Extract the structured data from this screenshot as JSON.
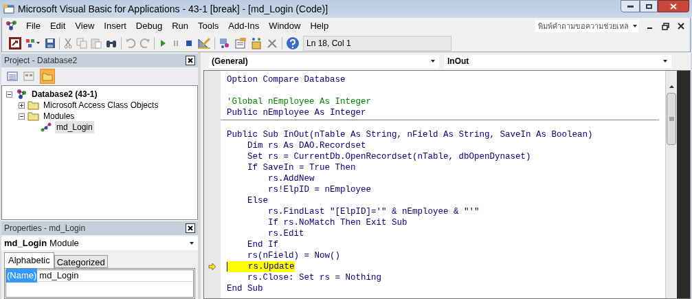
{
  "window": {
    "title": "Microsoft Visual Basic for Applications - 43-1 [break] - [md_Login (Code)]"
  },
  "menu": [
    "File",
    "Edit",
    "View",
    "Insert",
    "Debug",
    "Run",
    "Tools",
    "Add-Ins",
    "Window",
    "Help"
  ],
  "help_box": {
    "placeholder": "พิมพ์คำถามขอความช่วยเหล"
  },
  "toolbar": {
    "position": "Ln 18, Col 1"
  },
  "project": {
    "title": "Project - Database2",
    "tree": [
      {
        "label": "Database2 (43-1)",
        "kind": "project",
        "expanded": true,
        "children": [
          {
            "label": "Microsoft Access Class Objects",
            "kind": "folder",
            "expanded": false
          },
          {
            "label": "Modules",
            "kind": "folder",
            "expanded": true,
            "children": [
              {
                "label": "md_Login",
                "kind": "module",
                "selected": true
              }
            ]
          }
        ]
      }
    ]
  },
  "properties": {
    "title": "Properties - md_Login",
    "object": "md_Login",
    "object_type": "Module",
    "tabs": [
      {
        "label": "Alphabetic",
        "selected": true
      },
      {
        "label": "Categorized",
        "selected": false
      }
    ],
    "rows": [
      {
        "name": "(Name)",
        "value": "md_Login",
        "selected": true
      }
    ]
  },
  "code": {
    "object": "(General)",
    "procedure": "InOut",
    "lines": [
      {
        "kind": "code",
        "text": "Option Compare Database"
      },
      {
        "kind": "blank"
      },
      {
        "kind": "comment",
        "text": "'Global nEmployee As Integer"
      },
      {
        "kind": "code",
        "text": "Public nEmployee As Integer"
      },
      {
        "kind": "divider"
      },
      {
        "kind": "code",
        "text": "Public Sub InOut(nTable As String, nField As String, SaveIn As Boolean)"
      },
      {
        "kind": "code",
        "text": "    Dim rs As DAO.Recordset"
      },
      {
        "kind": "code",
        "text": "    Set rs = CurrentDb.OpenRecordset(nTable, dbOpenDynaset)"
      },
      {
        "kind": "code",
        "text": "    If SaveIn = True Then"
      },
      {
        "kind": "code",
        "text": "        rs.AddNew"
      },
      {
        "kind": "code",
        "text": "        rs!ElpID = nEmployee"
      },
      {
        "kind": "code",
        "text": "    Else"
      },
      {
        "kind": "code",
        "text": "        rs.FindLast \"[ElpID]='\" & nEmployee & \"'\""
      },
      {
        "kind": "code",
        "text": "        If rs.NoMatch Then Exit Sub"
      },
      {
        "kind": "code",
        "text": "        rs.Edit"
      },
      {
        "kind": "code",
        "text": "    End If"
      },
      {
        "kind": "code",
        "text": "    rs(nField) = Now()"
      },
      {
        "kind": "code",
        "text": "    rs.Update",
        "current": true
      },
      {
        "kind": "code",
        "text": "    rs.Close: Set rs = Nothing"
      },
      {
        "kind": "code",
        "text": "End Sub"
      }
    ]
  }
}
